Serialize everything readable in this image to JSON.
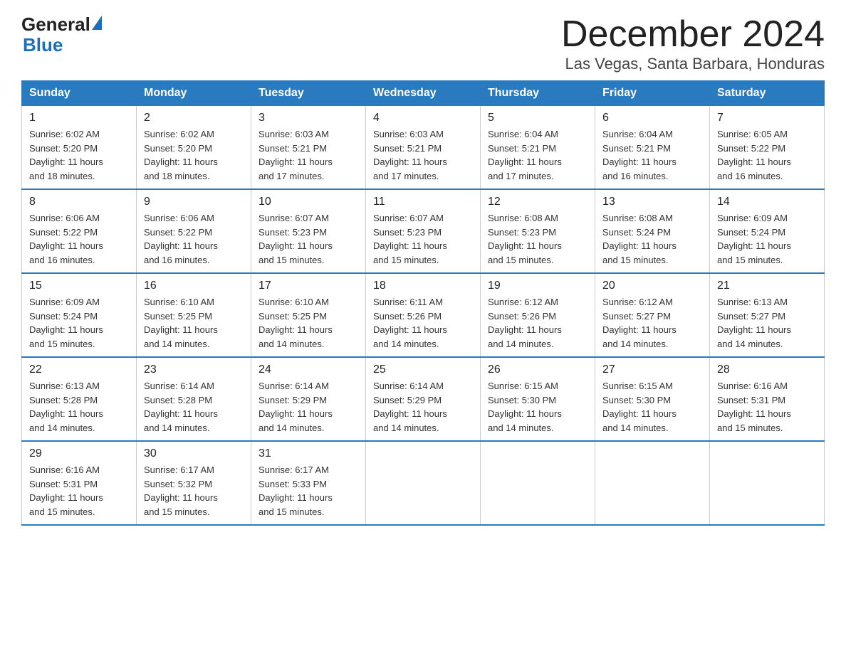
{
  "logo": {
    "general": "General",
    "blue": "Blue"
  },
  "title": "December 2024",
  "subtitle": "Las Vegas, Santa Barbara, Honduras",
  "days_header": [
    "Sunday",
    "Monday",
    "Tuesday",
    "Wednesday",
    "Thursday",
    "Friday",
    "Saturday"
  ],
  "weeks": [
    [
      {
        "day": "1",
        "sunrise": "6:02 AM",
        "sunset": "5:20 PM",
        "daylight": "11 hours and 18 minutes."
      },
      {
        "day": "2",
        "sunrise": "6:02 AM",
        "sunset": "5:20 PM",
        "daylight": "11 hours and 18 minutes."
      },
      {
        "day": "3",
        "sunrise": "6:03 AM",
        "sunset": "5:21 PM",
        "daylight": "11 hours and 17 minutes."
      },
      {
        "day": "4",
        "sunrise": "6:03 AM",
        "sunset": "5:21 PM",
        "daylight": "11 hours and 17 minutes."
      },
      {
        "day": "5",
        "sunrise": "6:04 AM",
        "sunset": "5:21 PM",
        "daylight": "11 hours and 17 minutes."
      },
      {
        "day": "6",
        "sunrise": "6:04 AM",
        "sunset": "5:21 PM",
        "daylight": "11 hours and 16 minutes."
      },
      {
        "day": "7",
        "sunrise": "6:05 AM",
        "sunset": "5:22 PM",
        "daylight": "11 hours and 16 minutes."
      }
    ],
    [
      {
        "day": "8",
        "sunrise": "6:06 AM",
        "sunset": "5:22 PM",
        "daylight": "11 hours and 16 minutes."
      },
      {
        "day": "9",
        "sunrise": "6:06 AM",
        "sunset": "5:22 PM",
        "daylight": "11 hours and 16 minutes."
      },
      {
        "day": "10",
        "sunrise": "6:07 AM",
        "sunset": "5:23 PM",
        "daylight": "11 hours and 15 minutes."
      },
      {
        "day": "11",
        "sunrise": "6:07 AM",
        "sunset": "5:23 PM",
        "daylight": "11 hours and 15 minutes."
      },
      {
        "day": "12",
        "sunrise": "6:08 AM",
        "sunset": "5:23 PM",
        "daylight": "11 hours and 15 minutes."
      },
      {
        "day": "13",
        "sunrise": "6:08 AM",
        "sunset": "5:24 PM",
        "daylight": "11 hours and 15 minutes."
      },
      {
        "day": "14",
        "sunrise": "6:09 AM",
        "sunset": "5:24 PM",
        "daylight": "11 hours and 15 minutes."
      }
    ],
    [
      {
        "day": "15",
        "sunrise": "6:09 AM",
        "sunset": "5:24 PM",
        "daylight": "11 hours and 15 minutes."
      },
      {
        "day": "16",
        "sunrise": "6:10 AM",
        "sunset": "5:25 PM",
        "daylight": "11 hours and 14 minutes."
      },
      {
        "day": "17",
        "sunrise": "6:10 AM",
        "sunset": "5:25 PM",
        "daylight": "11 hours and 14 minutes."
      },
      {
        "day": "18",
        "sunrise": "6:11 AM",
        "sunset": "5:26 PM",
        "daylight": "11 hours and 14 minutes."
      },
      {
        "day": "19",
        "sunrise": "6:12 AM",
        "sunset": "5:26 PM",
        "daylight": "11 hours and 14 minutes."
      },
      {
        "day": "20",
        "sunrise": "6:12 AM",
        "sunset": "5:27 PM",
        "daylight": "11 hours and 14 minutes."
      },
      {
        "day": "21",
        "sunrise": "6:13 AM",
        "sunset": "5:27 PM",
        "daylight": "11 hours and 14 minutes."
      }
    ],
    [
      {
        "day": "22",
        "sunrise": "6:13 AM",
        "sunset": "5:28 PM",
        "daylight": "11 hours and 14 minutes."
      },
      {
        "day": "23",
        "sunrise": "6:14 AM",
        "sunset": "5:28 PM",
        "daylight": "11 hours and 14 minutes."
      },
      {
        "day": "24",
        "sunrise": "6:14 AM",
        "sunset": "5:29 PM",
        "daylight": "11 hours and 14 minutes."
      },
      {
        "day": "25",
        "sunrise": "6:14 AM",
        "sunset": "5:29 PM",
        "daylight": "11 hours and 14 minutes."
      },
      {
        "day": "26",
        "sunrise": "6:15 AM",
        "sunset": "5:30 PM",
        "daylight": "11 hours and 14 minutes."
      },
      {
        "day": "27",
        "sunrise": "6:15 AM",
        "sunset": "5:30 PM",
        "daylight": "11 hours and 14 minutes."
      },
      {
        "day": "28",
        "sunrise": "6:16 AM",
        "sunset": "5:31 PM",
        "daylight": "11 hours and 15 minutes."
      }
    ],
    [
      {
        "day": "29",
        "sunrise": "6:16 AM",
        "sunset": "5:31 PM",
        "daylight": "11 hours and 15 minutes."
      },
      {
        "day": "30",
        "sunrise": "6:17 AM",
        "sunset": "5:32 PM",
        "daylight": "11 hours and 15 minutes."
      },
      {
        "day": "31",
        "sunrise": "6:17 AM",
        "sunset": "5:33 PM",
        "daylight": "11 hours and 15 minutes."
      },
      null,
      null,
      null,
      null
    ]
  ]
}
